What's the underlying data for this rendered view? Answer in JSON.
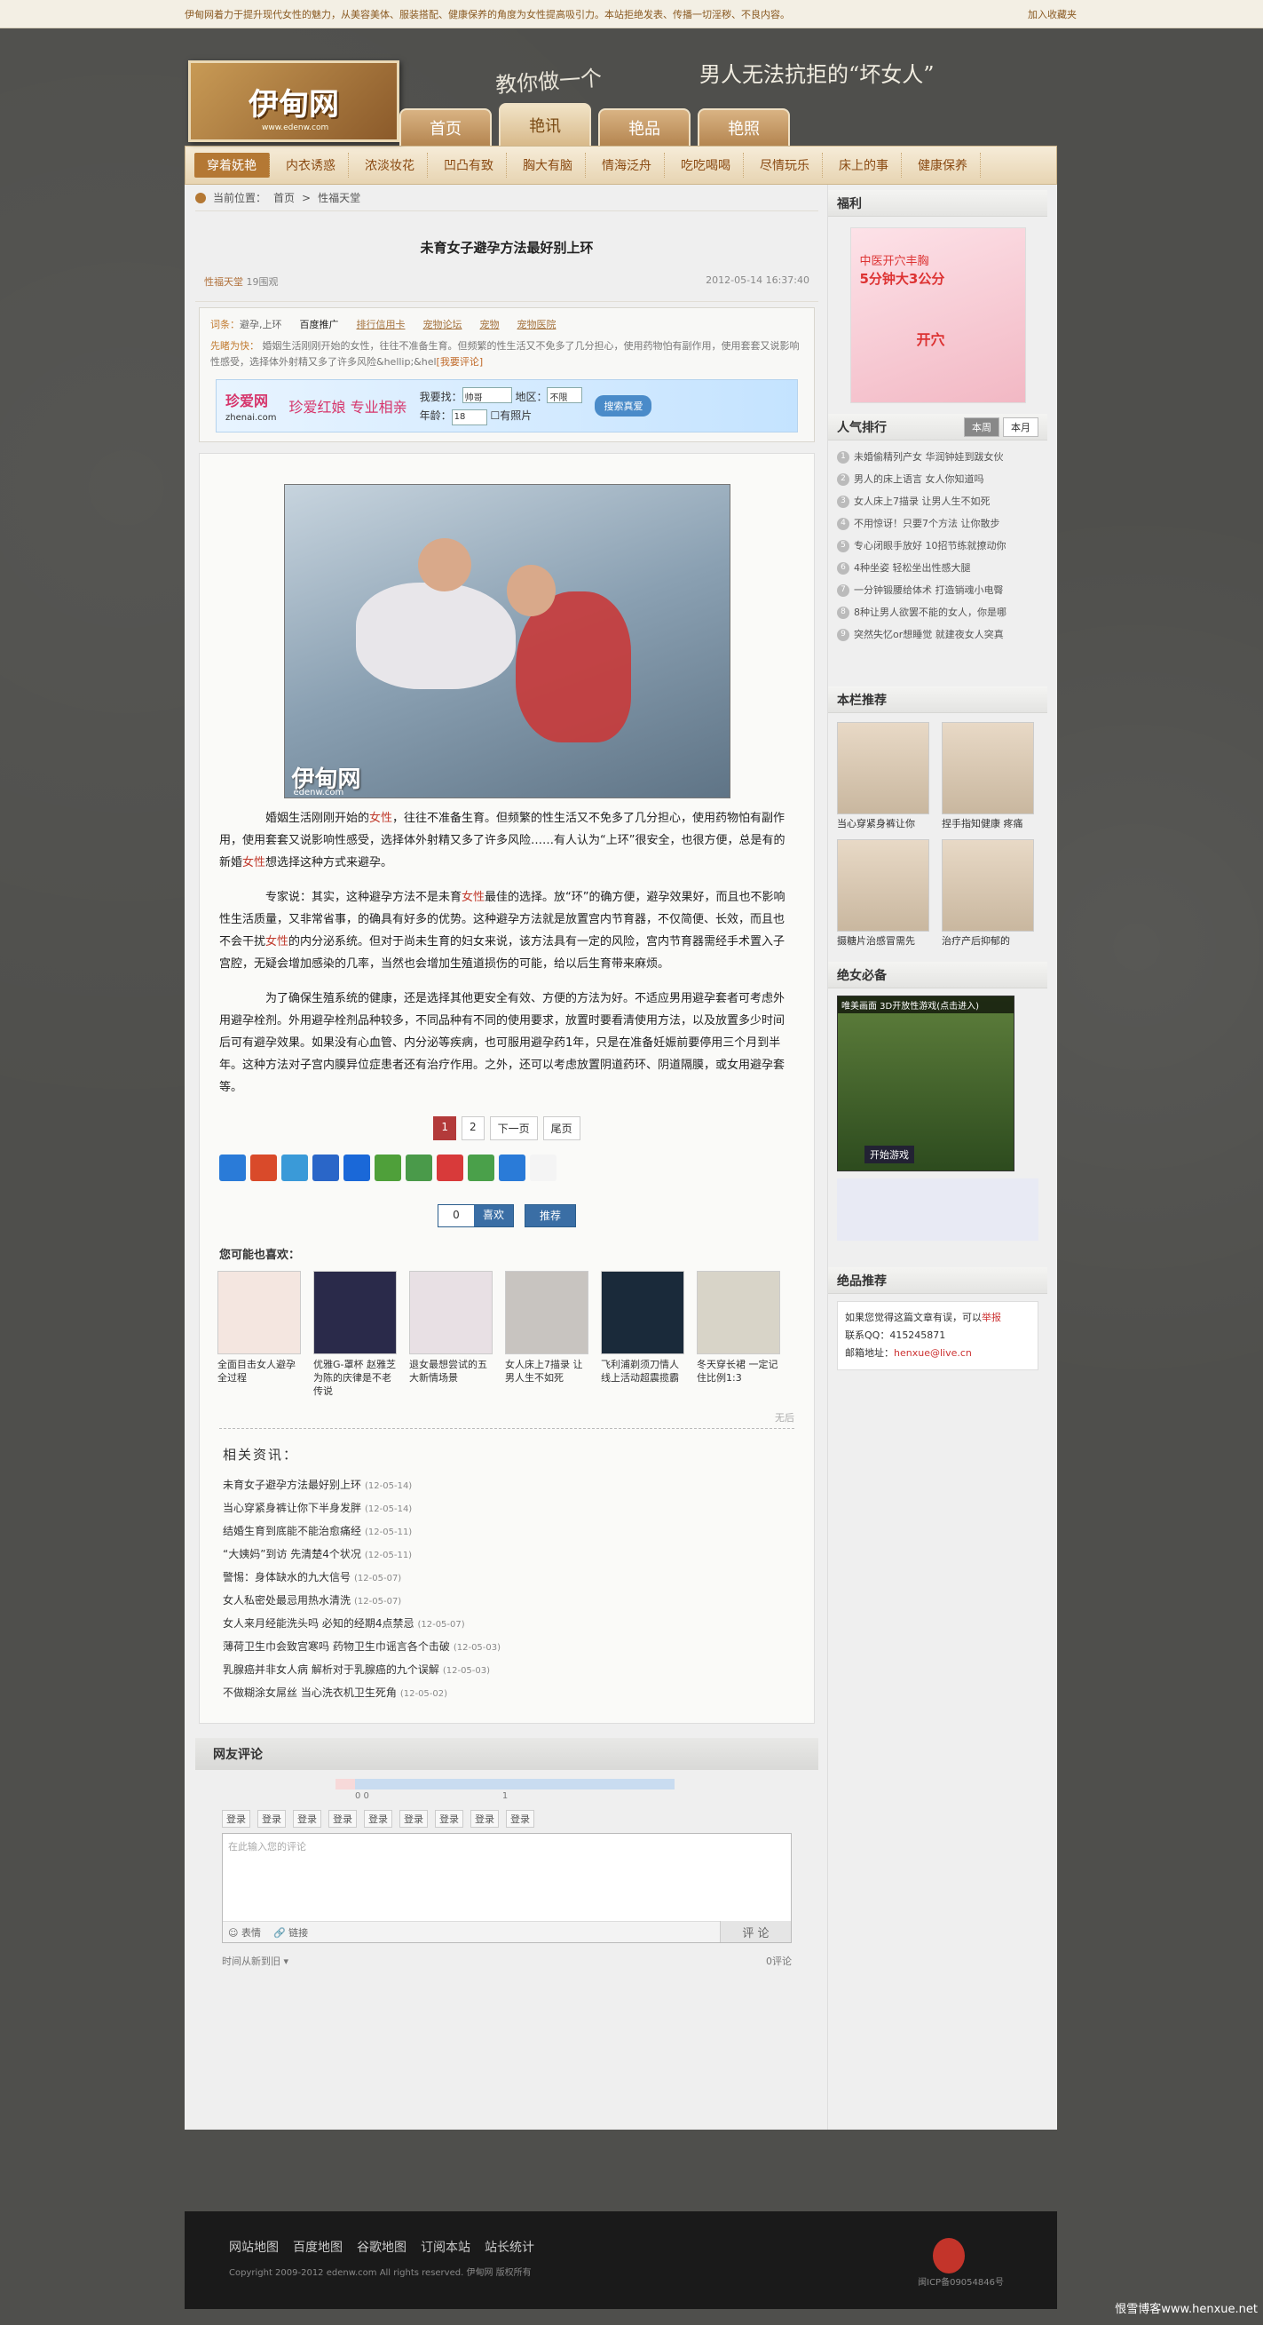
{
  "topbar": {
    "notice": "伊甸网着力于提升现代女性的魅力，从美容美体、服装搭配、健康保养的角度为女性提高吸引力。本站拒绝发表、传播一切淫秽、不良内容。",
    "fav": "加入收藏夹"
  },
  "header": {
    "logo": "伊甸网",
    "logo_url": "www.edenw.com",
    "slogan1": "教你做一个",
    "slogan2": "男人无法抗拒的“坏女人”"
  },
  "tabs": [
    "首页",
    "艳讯",
    "艳品",
    "艳照"
  ],
  "nav": [
    "穿着妩艳",
    "内衣诱惑",
    "浓淡妆花",
    "凹凸有致",
    "胸大有脑",
    "情海泛舟",
    "吃吃喝喝",
    "尽情玩乐",
    "床上的事",
    "健康保养"
  ],
  "crumb": {
    "prefix": "当前位置：",
    "home": "首页",
    "sep": ">",
    "cat": "性福天堂"
  },
  "article": {
    "title": "未育女子避孕方法最好别上环",
    "category": "性福天堂",
    "views": "19围观",
    "date": "2012-05-14 16:37:40",
    "kw_label": "词条：",
    "kw_values": "避孕,上环",
    "kw_links": [
      "百度推广",
      "排行信用卡",
      "宠物论坛",
      "宠物",
      "宠物医院"
    ],
    "summary_label": "先睹为快：",
    "summary": "婚姻生活刚刚开始的女性，往往不准备生育。但频繁的性生活又不免多了几分担心，使用药物怕有副作用，使用套套又说影响性感受，选择体外射精又多了许多风险&hellip;&hel",
    "summary_link": "[我要评论]",
    "ad": {
      "brand": "珍爱网",
      "brand_en": "zhenai.com",
      "slogan": "珍爱红娘 专业相亲",
      "find": "我要找：",
      "find_val": "帅哥",
      "area": "地区：",
      "area_val": "不限",
      "age": "年龄：",
      "age_val": "18",
      "photo": "有照片",
      "go": "搜索真爱"
    },
    "photo_wm": "伊甸网",
    "photo_wm2": "edenw.com",
    "p1a": "婚姻生活刚刚开始的",
    "p1b": "女性",
    "p1c": "，往往不准备生育。但频繁的性生活又不免多了几分担心，使用药物怕有副作用，使用套套又说影响性感受，选择体外射精又多了许多风险……有人认为“上环”很安全，也很方便，总是有的新婚",
    "p1d": "女性",
    "p1e": "想选择这种方式来避孕。",
    "p2a": "专家说：其实，这种避孕方法不是未育",
    "p2b": "女性",
    "p2c": "最佳的选择。放“环”的确方便，避孕效果好，而且也不影响性生活质量，又非常省事，的确具有好多的优势。这种避孕方法就是放置宫内节育器，不仅简便、长效，而且也不会干扰",
    "p2d": "女性",
    "p2e": "的内分泌系统。但对于尚未生育的妇女来说，该方法具有一定的风险，宫内节育器需经手术置入子宫腔，无疑会增加感染的几率，当然也会增加生殖道损伤的可能，给以后生育带来麻烦。",
    "p3": "为了确保生殖系统的健康，还是选择其他更安全有效、方便的方法为好。不适应男用避孕套者可考虑外用避孕栓剂。外用避孕栓剂品种较多，不同品种有不同的使用要求，放置时要看清使用方法，以及放置多少时间后可有避孕效果。如果没有心血管、内分泌等疾病，也可服用避孕药1年，只是在准备妊娠前要停用三个月到半年。这种方法对子宫内膜异位症患者还有治疗作用。之外，还可以考虑放置阴道药环、阴道隔膜，或女用避孕套等。",
    "pager": [
      "1",
      "2",
      "下一页",
      "尾页"
    ],
    "vote_count": "0",
    "vote_like": "喜欢",
    "vote_rec": "推荐"
  },
  "share_colors": [
    "#2a7bd8",
    "#d94a2a",
    "#3a9ad8",
    "#2a66c8",
    "#1a68d8",
    "#4fa03a",
    "#4a9a4a",
    "#d83a3a",
    "#4aa04a",
    "#2a7bd8",
    "#f4f4f4"
  ],
  "likes": {
    "title": "您可能也喜欢：",
    "items": [
      "全面目击女人避孕全过程",
      "优雅G-罩杯 赵雅芝为陈的庆律是不老传说",
      "退女最想尝试的五大新情场景",
      "女人床上7描录 让男人生不如死",
      "飞利浦剃须刀情人线上活动超震揽霸",
      "冬天穿长裙 一定记住比例1:3"
    ],
    "colors": [
      "#f4e6e0",
      "#2a2a4a",
      "#e8e0e4",
      "#c8c4c0",
      "#1a2a3a",
      "#d8d4c8"
    ],
    "none": "无后"
  },
  "related": {
    "title": "相关资讯：",
    "items": [
      {
        "t": "未育女子避孕方法最好别上环",
        "d": "(12-05-14)"
      },
      {
        "t": "当心穿紧身裤让你下半身发胖",
        "d": "(12-05-14)"
      },
      {
        "t": "结婚生育到底能不能治愈痛经",
        "d": "(12-05-11)"
      },
      {
        "t": "“大姨妈”到访 先清楚4个状况",
        "d": "(12-05-11)"
      },
      {
        "t": "警惕：身体缺水的九大信号",
        "d": "(12-05-07)"
      },
      {
        "t": "女人私密处最忌用热水清洗",
        "d": "(12-05-07)"
      },
      {
        "t": "女人来月经能洗头吗 必知的经期4点禁忌",
        "d": "(12-05-07)"
      },
      {
        "t": "薄荷卫生巾会致宫寒吗 药物卫生巾谣言各个击破",
        "d": "(12-05-03)"
      },
      {
        "t": "乳腺癌并非女人病 解析对于乳腺癌的九个误解",
        "d": "(12-05-03)"
      },
      {
        "t": "不做糊涂女屌丝 当心洗衣机卫生死角",
        "d": "(12-05-02)"
      }
    ]
  },
  "comments": {
    "title": "网友评论",
    "bar_left": "0 0",
    "bar_mid": "1",
    "logins": [
      "登录",
      "登录",
      "登录",
      "登录",
      "登录",
      "登录",
      "登录",
      "登录",
      "登录"
    ],
    "placeholder": "在此输入您的评论",
    "face": "表情",
    "link": "链接",
    "send": "评 论",
    "sort": "时间从新到旧",
    "count": "0评论"
  },
  "side": {
    "fuli": "福利",
    "fuli_t1": "中医开穴丰胸",
    "fuli_t2": "5分钟大3公分",
    "fuli_t3": "开穴",
    "rank_title": "人气排行",
    "rank_tabs": [
      "本周",
      "本月"
    ],
    "rank": [
      "未婚偷精列产女 华润钟娃到跋女伙",
      "男人的床上语言 女人你知道吗",
      "女人床上7描录 让男人生不如死",
      "不用惊讶！只要7个方法 让你散步",
      "专心闭眼手放好 10招节练就撩动你",
      "4种坐姿 轻松坐出性感大腿",
      "一分钟锻腰给体术 打造销魂小电臀",
      "8种让男人欲罢不能的女人，你是哪",
      "突然失忆or想睡觉 就建夜女人突真"
    ],
    "rec_title": "本栏推荐",
    "rec": [
      "当心穿紧身裤让你",
      "捏手指知健康 疼痛",
      "摄糖片治感冒需先",
      "治疗产后抑郁的"
    ],
    "game_title": "绝女必备",
    "game_top": "唯美画面 3D开放性游戏(点击进入)",
    "game_btn": "开始游戏",
    "best_title": "绝品推荐",
    "best_l1": "如果您觉得这篇文章有误，可以",
    "best_l1r": "举报",
    "best_l2": "联系QQ：415245871",
    "best_l3": "邮箱地址：",
    "best_l3r": "henxue@live.cn"
  },
  "footer": {
    "links": [
      "网站地图",
      "百度地图",
      "谷歌地图",
      "订阅本站",
      "站长统计"
    ],
    "copy": "Copyright 2009-2012 edenw.com All rights reserved. 伊甸网 版权所有",
    "icp": "闽ICP备09054846号",
    "brand": "恨雪博客www.henxue.net"
  }
}
